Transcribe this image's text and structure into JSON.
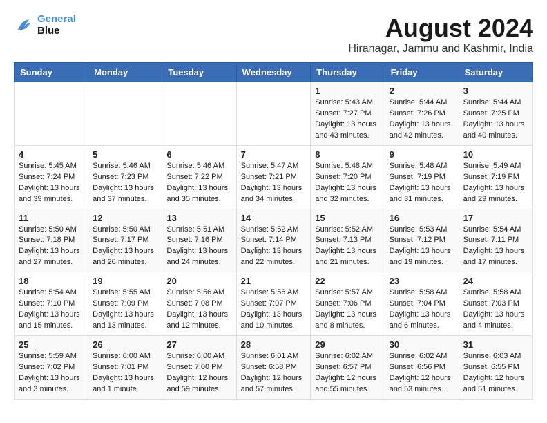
{
  "header": {
    "logo_line1": "General",
    "logo_line2": "Blue",
    "month_year": "August 2024",
    "location": "Hiranagar, Jammu and Kashmir, India"
  },
  "weekdays": [
    "Sunday",
    "Monday",
    "Tuesday",
    "Wednesday",
    "Thursday",
    "Friday",
    "Saturday"
  ],
  "weeks": [
    [
      {
        "day": "",
        "info": ""
      },
      {
        "day": "",
        "info": ""
      },
      {
        "day": "",
        "info": ""
      },
      {
        "day": "",
        "info": ""
      },
      {
        "day": "1",
        "info": "Sunrise: 5:43 AM\nSunset: 7:27 PM\nDaylight: 13 hours\nand 43 minutes."
      },
      {
        "day": "2",
        "info": "Sunrise: 5:44 AM\nSunset: 7:26 PM\nDaylight: 13 hours\nand 42 minutes."
      },
      {
        "day": "3",
        "info": "Sunrise: 5:44 AM\nSunset: 7:25 PM\nDaylight: 13 hours\nand 40 minutes."
      }
    ],
    [
      {
        "day": "4",
        "info": "Sunrise: 5:45 AM\nSunset: 7:24 PM\nDaylight: 13 hours\nand 39 minutes."
      },
      {
        "day": "5",
        "info": "Sunrise: 5:46 AM\nSunset: 7:23 PM\nDaylight: 13 hours\nand 37 minutes."
      },
      {
        "day": "6",
        "info": "Sunrise: 5:46 AM\nSunset: 7:22 PM\nDaylight: 13 hours\nand 35 minutes."
      },
      {
        "day": "7",
        "info": "Sunrise: 5:47 AM\nSunset: 7:21 PM\nDaylight: 13 hours\nand 34 minutes."
      },
      {
        "day": "8",
        "info": "Sunrise: 5:48 AM\nSunset: 7:20 PM\nDaylight: 13 hours\nand 32 minutes."
      },
      {
        "day": "9",
        "info": "Sunrise: 5:48 AM\nSunset: 7:19 PM\nDaylight: 13 hours\nand 31 minutes."
      },
      {
        "day": "10",
        "info": "Sunrise: 5:49 AM\nSunset: 7:19 PM\nDaylight: 13 hours\nand 29 minutes."
      }
    ],
    [
      {
        "day": "11",
        "info": "Sunrise: 5:50 AM\nSunset: 7:18 PM\nDaylight: 13 hours\nand 27 minutes."
      },
      {
        "day": "12",
        "info": "Sunrise: 5:50 AM\nSunset: 7:17 PM\nDaylight: 13 hours\nand 26 minutes."
      },
      {
        "day": "13",
        "info": "Sunrise: 5:51 AM\nSunset: 7:16 PM\nDaylight: 13 hours\nand 24 minutes."
      },
      {
        "day": "14",
        "info": "Sunrise: 5:52 AM\nSunset: 7:14 PM\nDaylight: 13 hours\nand 22 minutes."
      },
      {
        "day": "15",
        "info": "Sunrise: 5:52 AM\nSunset: 7:13 PM\nDaylight: 13 hours\nand 21 minutes."
      },
      {
        "day": "16",
        "info": "Sunrise: 5:53 AM\nSunset: 7:12 PM\nDaylight: 13 hours\nand 19 minutes."
      },
      {
        "day": "17",
        "info": "Sunrise: 5:54 AM\nSunset: 7:11 PM\nDaylight: 13 hours\nand 17 minutes."
      }
    ],
    [
      {
        "day": "18",
        "info": "Sunrise: 5:54 AM\nSunset: 7:10 PM\nDaylight: 13 hours\nand 15 minutes."
      },
      {
        "day": "19",
        "info": "Sunrise: 5:55 AM\nSunset: 7:09 PM\nDaylight: 13 hours\nand 13 minutes."
      },
      {
        "day": "20",
        "info": "Sunrise: 5:56 AM\nSunset: 7:08 PM\nDaylight: 13 hours\nand 12 minutes."
      },
      {
        "day": "21",
        "info": "Sunrise: 5:56 AM\nSunset: 7:07 PM\nDaylight: 13 hours\nand 10 minutes."
      },
      {
        "day": "22",
        "info": "Sunrise: 5:57 AM\nSunset: 7:06 PM\nDaylight: 13 hours\nand 8 minutes."
      },
      {
        "day": "23",
        "info": "Sunrise: 5:58 AM\nSunset: 7:04 PM\nDaylight: 13 hours\nand 6 minutes."
      },
      {
        "day": "24",
        "info": "Sunrise: 5:58 AM\nSunset: 7:03 PM\nDaylight: 13 hours\nand 4 minutes."
      }
    ],
    [
      {
        "day": "25",
        "info": "Sunrise: 5:59 AM\nSunset: 7:02 PM\nDaylight: 13 hours\nand 3 minutes."
      },
      {
        "day": "26",
        "info": "Sunrise: 6:00 AM\nSunset: 7:01 PM\nDaylight: 13 hours\nand 1 minute."
      },
      {
        "day": "27",
        "info": "Sunrise: 6:00 AM\nSunset: 7:00 PM\nDaylight: 12 hours\nand 59 minutes."
      },
      {
        "day": "28",
        "info": "Sunrise: 6:01 AM\nSunset: 6:58 PM\nDaylight: 12 hours\nand 57 minutes."
      },
      {
        "day": "29",
        "info": "Sunrise: 6:02 AM\nSunset: 6:57 PM\nDaylight: 12 hours\nand 55 minutes."
      },
      {
        "day": "30",
        "info": "Sunrise: 6:02 AM\nSunset: 6:56 PM\nDaylight: 12 hours\nand 53 minutes."
      },
      {
        "day": "31",
        "info": "Sunrise: 6:03 AM\nSunset: 6:55 PM\nDaylight: 12 hours\nand 51 minutes."
      }
    ]
  ]
}
